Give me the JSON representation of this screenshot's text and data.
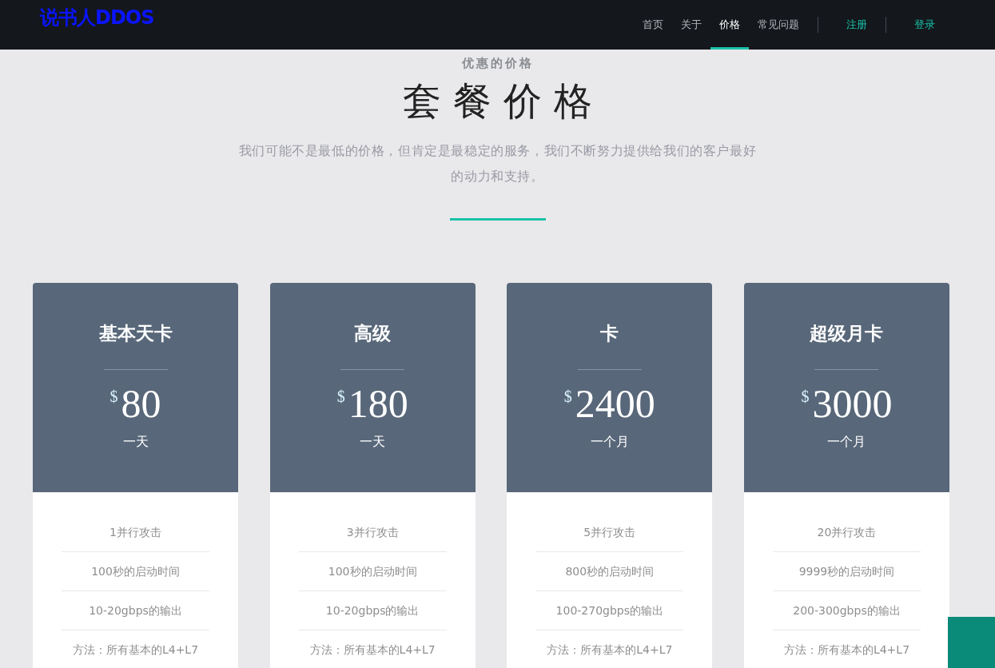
{
  "header": {
    "logo": "说书人DDOS",
    "nav": [
      {
        "label": "首页",
        "selected": false,
        "kind": "page"
      },
      {
        "label": "关于",
        "selected": false,
        "kind": "page"
      },
      {
        "label": "价格",
        "selected": true,
        "kind": "page"
      },
      {
        "label": "常见问题",
        "selected": false,
        "kind": "page"
      },
      {
        "label": "注册",
        "selected": false,
        "kind": "account"
      },
      {
        "label": "登录",
        "selected": false,
        "kind": "account"
      }
    ]
  },
  "intro": {
    "eyebrow": "优惠的价格",
    "title": "套 餐 价 格",
    "text": "我们可能不是最低的价格，但肯定是最稳定的服务，我们不断努力提供给我们的客户最好的动力和支持。"
  },
  "plans": [
    {
      "name": "基本天卡",
      "currency": "$",
      "price": "80",
      "period": "一天",
      "features": [
        "1并行攻击",
        "100秒的启动时间",
        "10-20gbps的输出",
        "方法：所有基本的L4+L7"
      ]
    },
    {
      "name": "高级",
      "currency": "$",
      "price": "180",
      "period": "一天",
      "features": [
        "3并行攻击",
        "100秒的启动时间",
        "10-20gbps的输出",
        "方法：所有基本的L4+L7"
      ]
    },
    {
      "name": "卡",
      "currency": "$",
      "price": "2400",
      "period": "一个月",
      "features": [
        "5并行攻击",
        "800秒的启动时间",
        "100-270gbps的输出",
        "方法：所有基本的L4+L7"
      ]
    },
    {
      "name": "超级月卡",
      "currency": "$",
      "price": "3000",
      "period": "一个月",
      "features": [
        "20并行攻击",
        "9999秒的启动时间",
        "200-300gbps的输出",
        "方法：所有基本的L4+L7"
      ]
    }
  ]
}
